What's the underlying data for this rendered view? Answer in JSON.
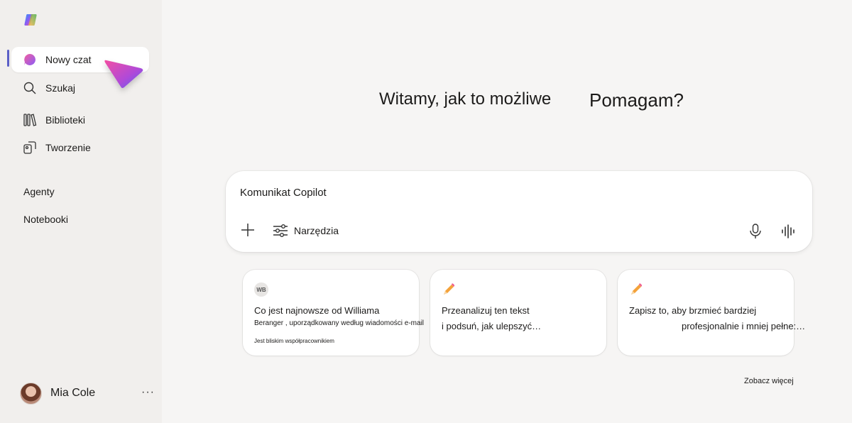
{
  "sidebar": {
    "items": [
      {
        "label": "Nowy czat",
        "icon": "chat-bubble-icon"
      },
      {
        "label": "Szukaj",
        "icon": "search-icon"
      },
      {
        "label": "Biblioteki",
        "icon": "library-icon"
      },
      {
        "label": "Tworzenie",
        "icon": "create-icon"
      }
    ],
    "sections": [
      {
        "label": "Agenty"
      },
      {
        "label": "Notebooki"
      }
    ],
    "user": {
      "name": "Mia Cole",
      "more": "···"
    }
  },
  "main": {
    "welcome_part1": "Witamy, jak to możliwe",
    "welcome_part2": "Pomagam?",
    "composer": {
      "placeholder": "Komunikat Copilot",
      "tools_label": "Narzędzia"
    },
    "cards": [
      {
        "badge": "WB",
        "line1": "Co jest najnowsze od Williama",
        "line2": "Beranger , uporządkowany według wiadomości e-mail",
        "line3": "Jest bliskim współpracownikiem"
      },
      {
        "icon": "pencil-icon",
        "line1": "Przeanalizuj ten tekst",
        "line2": "i podsuń, jak ulepszyć…"
      },
      {
        "icon": "pencil-icon",
        "line1": "Zapisz to, aby brzmieć bardziej",
        "line2": "profesjonalnie i mniej pełne:…"
      }
    ],
    "see_more": "Zobacz więcej"
  },
  "colors": {
    "accent": "#5b5fc7",
    "background": "#f6f5f4",
    "sidebar": "#f1efed"
  }
}
